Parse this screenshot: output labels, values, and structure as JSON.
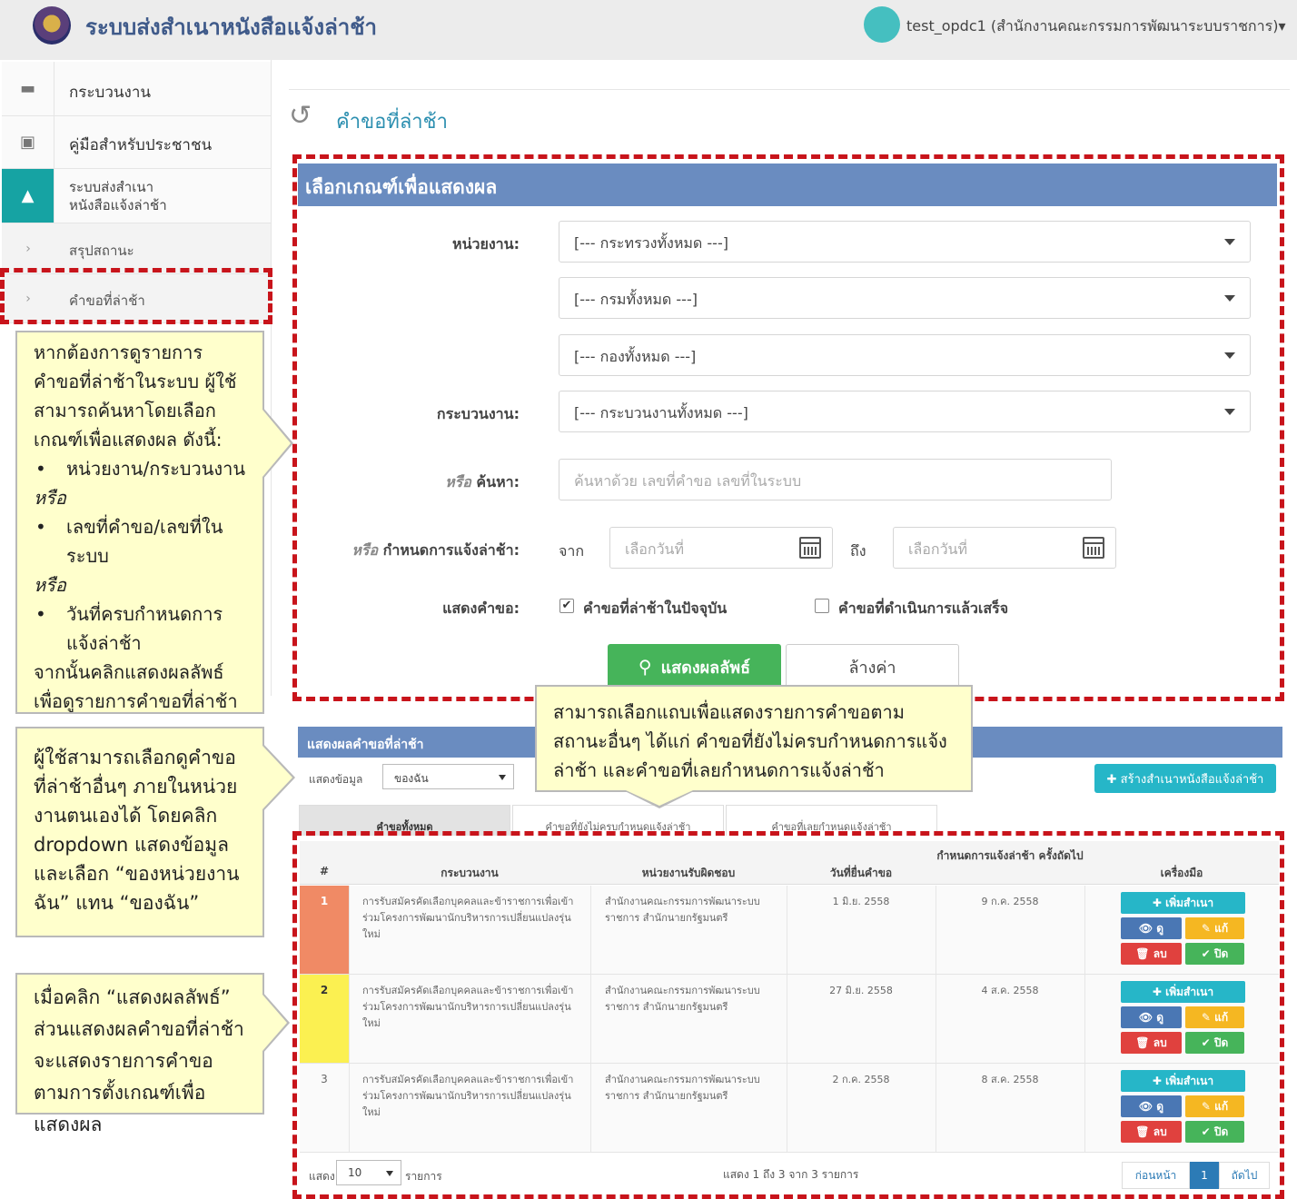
{
  "header": {
    "app_title": "ระบบส่งสำเนาหนังสือแจ้งล่าช้า",
    "user": "test_opdc1 (สำนักงานคณะกรรมการพัฒนาระบบราชการ)▾"
  },
  "sidebar": {
    "items": [
      {
        "label": "กระบวนงาน",
        "icon": "folder-icon"
      },
      {
        "label": "คู่มือสำหรับประชาชน",
        "icon": "archive-icon"
      },
      {
        "label": "ระบบส่งสำเนา หนังสือแจ้งล่าช้า",
        "icon": "warning-icon"
      },
      {
        "label": "สรุปสถานะ",
        "icon": "chevron-right-icon"
      },
      {
        "label": "คำขอที่ล่าช้า",
        "icon": "chevron-right-icon"
      }
    ]
  },
  "page": {
    "title": "คำขอที่ล่าช้า"
  },
  "criteria": {
    "title": "เลือกเกณฑ์เพื่อแสดงผล",
    "agency_label": "หน่วยงาน:",
    "ministry_value": "[--- กระทรวงทั้งหมด ---]",
    "department_value": "[--- กรมทั้งหมด ---]",
    "division_value": "[--- กองทั้งหมด ---]",
    "process_label": "กระบวนงาน:",
    "process_value": "[--- กระบวนงานทั้งหมด ---]",
    "search_label_or": "หรือ",
    "search_label": " ค้นหา:",
    "search_placeholder": "ค้นหาด้วย เลขที่คำขอ เลขที่ในระบบ",
    "due_label_or": "หรือ",
    "due_label": " กำหนดการแจ้งล่าช้า:",
    "from_label": "จาก",
    "to_label": "ถึง",
    "date_placeholder": "เลือกวันที่",
    "show_label": "แสดงคำขอ:",
    "check_current": "คำขอที่ล่าช้าในปัจจุบัน",
    "check_done": "คำขอที่ดำเนินการแล้วเสร็จ",
    "search_button": "แสดงผลลัพธ์",
    "clear_button": "ล้างค่า"
  },
  "callouts": {
    "search_intro": "หากต้องการดูรายการคำขอที่ล่าช้าในระบบ ผู้ใช้สามารถค้นหาโดยเลือกเกณฑ์เพื่อแสดงผล ดังนี้:",
    "opt1": "หน่วยงาน/กระบวนงาน",
    "or1": "หรือ",
    "opt2": "เลขที่คำขอ/เลขที่ในระบบ",
    "or2": "หรือ",
    "opt3": "วันที่ครบกำหนดการแจ้งล่าช้า",
    "outro": "จากนั้นคลิกแสดงผลลัพธ์เพื่อดูรายการคำขอที่ล่าช้า",
    "dropdown_tip": "ผู้ใช้สามารถเลือกดูคำขอที่ล่าช้าอื่นๆ ภายในหน่วยงานตนเองได้ โดยคลิก dropdown แสดงข้อมูล และเลือก “ของหน่วยงานฉัน” แทน “ของฉัน”",
    "result_tip": "เมื่อคลิก “แสดงผลลัพธ์” ส่วนแสดงผลคำขอที่ล่าช้าจะแสดงรายการคำขอตามการตั้งเกณฑ์เพื่อแสดงผล",
    "tab_tip": "สามารถเลือกแถบเพื่อแสดงรายการคำขอตามสถานะอื่นๆ ได้แก่ คำขอที่ยังไม่ครบกำหนดการแจ้งล่าช้า และคำขอที่เลยกำหนดการแจ้งล่าช้า"
  },
  "results": {
    "title": "แสดงผลคำขอที่ล่าช้า",
    "show_data_label": "แสดงข้อมูล",
    "show_data_value": "ของฉัน",
    "create_button": "✚ สร้างสำเนาหนังสือแจ้งล่าช้า",
    "tabs": [
      "คำขอทั้งหมด",
      "คำขอที่ยังไม่ครบกำหนดแจ้งล่าช้า",
      "คำขอที่เลยกำหนดแจ้งล่าช้า"
    ],
    "columns": {
      "num": "#",
      "process": "กระบวนงาน",
      "agency": "หน่วยงานรับผิดชอบ",
      "date": "วันที่ยื่นคำขอ",
      "due": "กำหนดการแจ้งล่าช้า ครั้งถัดไป",
      "tools": "เครื่องมือ"
    },
    "rows": [
      {
        "num": "1",
        "color": "#f08a65",
        "process": "การรับสมัครคัดเลือกบุคคลและข้าราชการเพื่อเข้าร่วมโครงการพัฒนานักบริหารการเปลี่ยนแปลงรุ่นใหม่",
        "agency": "สำนักงานคณะกรรมการพัฒนาระบบราชการ สำนักนายกรัฐมนตรี",
        "date": "1 มิ.ย. 2558",
        "due": "9 ก.ค. 2558"
      },
      {
        "num": "2",
        "color": "#fbf051",
        "process": "การรับสมัครคัดเลือกบุคคลและข้าราชการเพื่อเข้าร่วมโครงการพัฒนานักบริหารการเปลี่ยนแปลงรุ่นใหม่",
        "agency": "สำนักงานคณะกรรมการพัฒนาระบบราชการ สำนักนายกรัฐมนตรี",
        "date": "27 มิ.ย. 2558",
        "due": "4 ส.ค. 2558"
      },
      {
        "num": "3",
        "color": "",
        "process": "การรับสมัครคัดเลือกบุคคลและข้าราชการเพื่อเข้าร่วมโครงการพัฒนานักบริหารการเปลี่ยนแปลงรุ่นใหม่",
        "agency": "สำนักงานคณะกรรมการพัฒนาระบบราชการ สำนักนายกรัฐมนตรี",
        "date": "2 ก.ค. 2558",
        "due": "8 ส.ค. 2558"
      }
    ],
    "actions": {
      "add": "✚ เพิ่มสำเนา",
      "view": "👁 ดู",
      "edit": "✎ แก้",
      "del": "🗑 ลบ",
      "close": "✔ ปิด"
    },
    "footer": {
      "show": "แสดง",
      "page_size": "10",
      "items": "รายการ",
      "summary": "แสดง 1 ถึง 3 จาก 3 รายการ",
      "prev": "ก่อนหน้า",
      "page": "1",
      "next": "ถัดไป"
    }
  }
}
